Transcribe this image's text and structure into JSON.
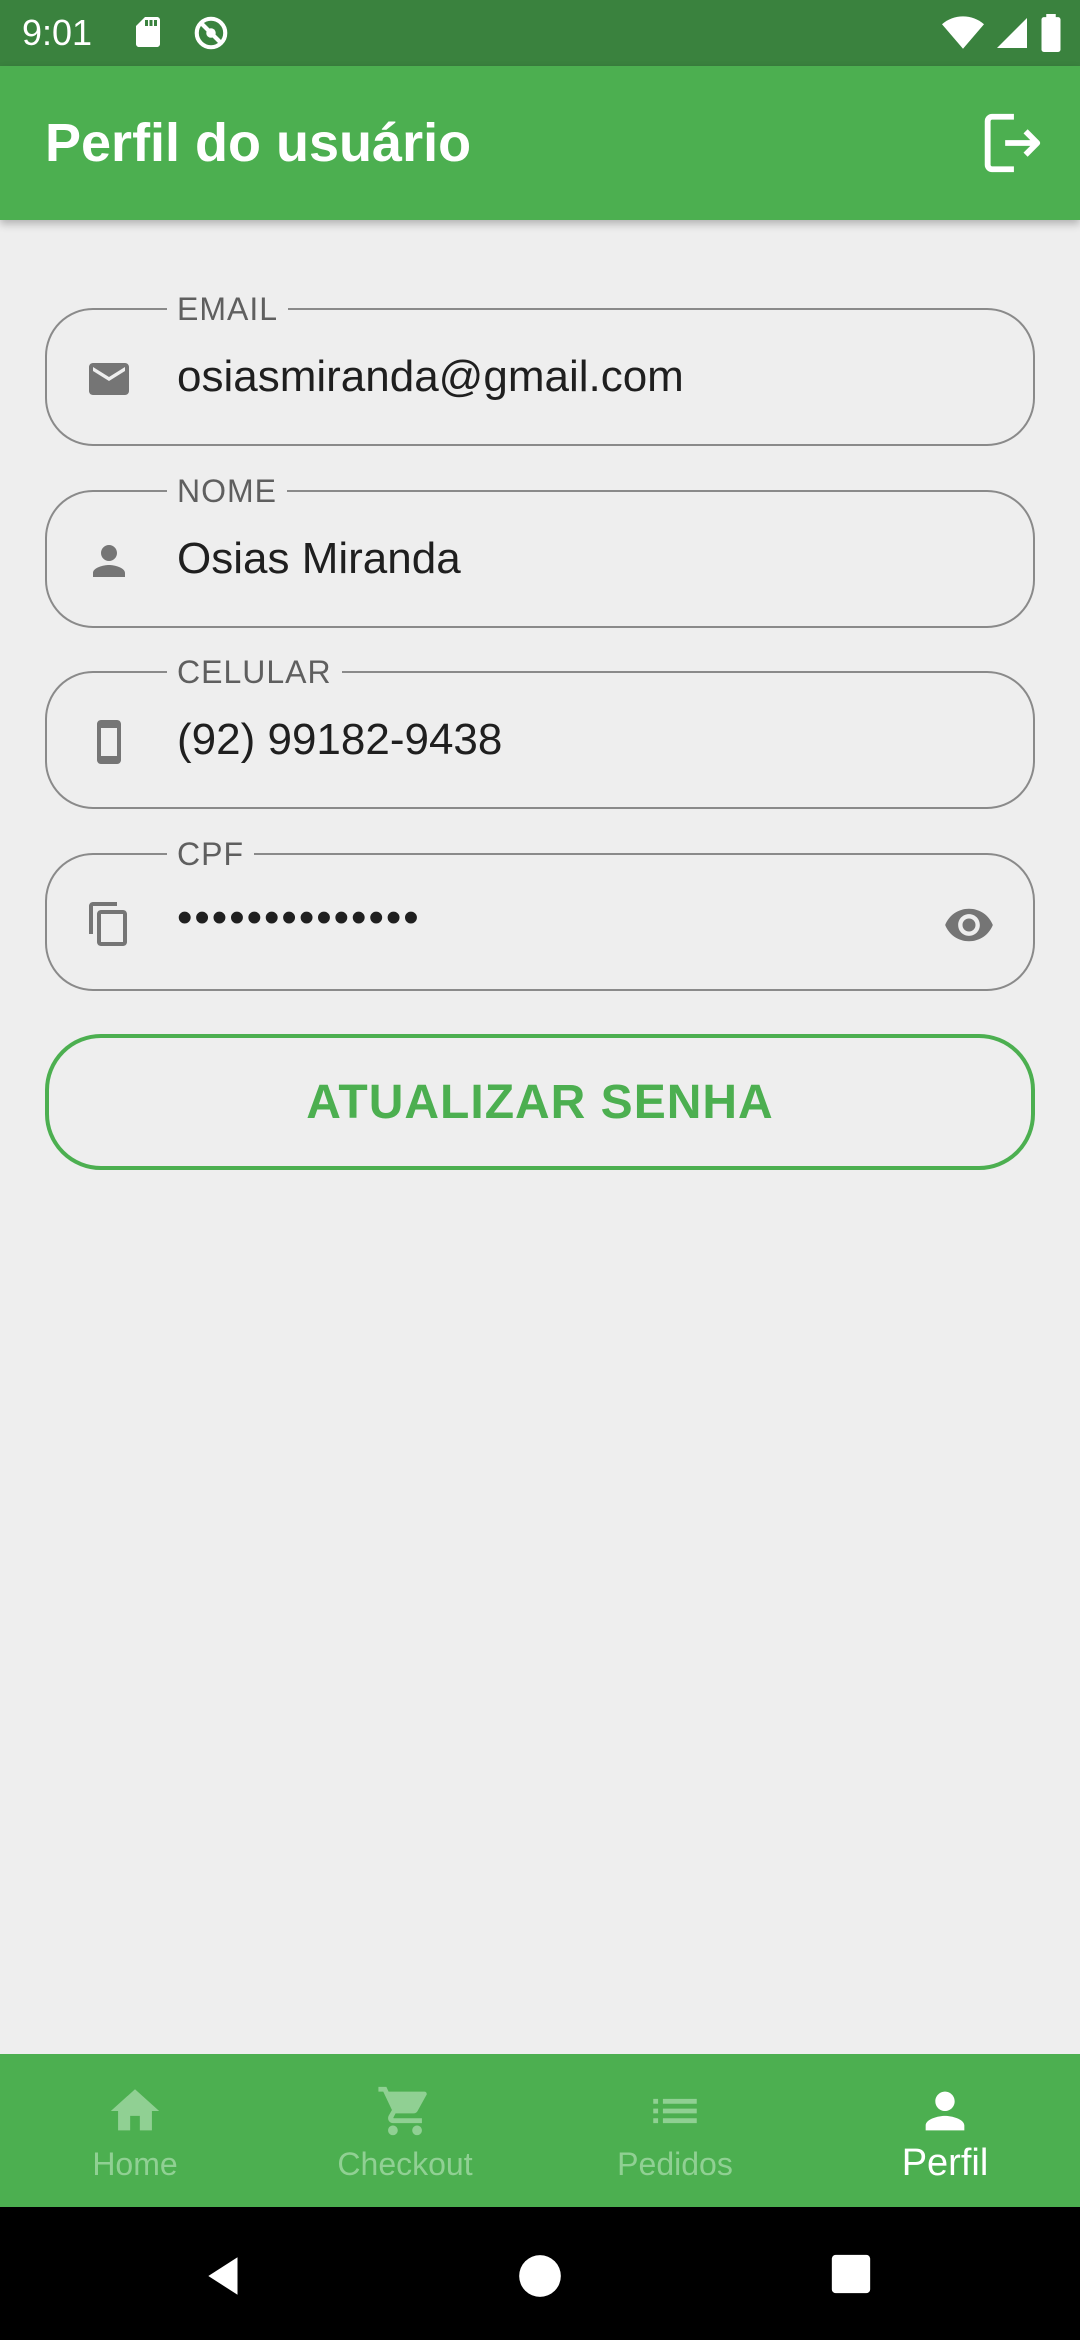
{
  "status_bar": {
    "time": "9:01"
  },
  "app_bar": {
    "title": "Perfil do usuário",
    "logout_icon": "logout-icon"
  },
  "fields": [
    {
      "label": "EMAIL",
      "value": "osiasmiranda@gmail.com",
      "icon": "email-icon"
    },
    {
      "label": "NOME",
      "value": "Osias Miranda",
      "icon": "person-icon"
    },
    {
      "label": "CELULAR",
      "value": "(92) 99182-9438",
      "icon": "phone-icon"
    },
    {
      "label": "CPF",
      "value": "••••••••••••••",
      "icon": "copy-icon",
      "trailing_icon": "eye-icon"
    }
  ],
  "update_button": {
    "label": "ATUALIZAR SENHA"
  },
  "bottom_nav": {
    "items": [
      {
        "label": "Home",
        "icon": "home-icon"
      },
      {
        "label": "Checkout",
        "icon": "cart-icon"
      },
      {
        "label": "Pedidos",
        "icon": "list-icon"
      },
      {
        "label": "Perfil",
        "icon": "person-icon"
      }
    ],
    "active": "Perfil"
  },
  "colors": {
    "primary": "#4caf50",
    "status_bar": "#3a823e",
    "background": "#eeeeee",
    "nav_inactive": "#90d093"
  }
}
